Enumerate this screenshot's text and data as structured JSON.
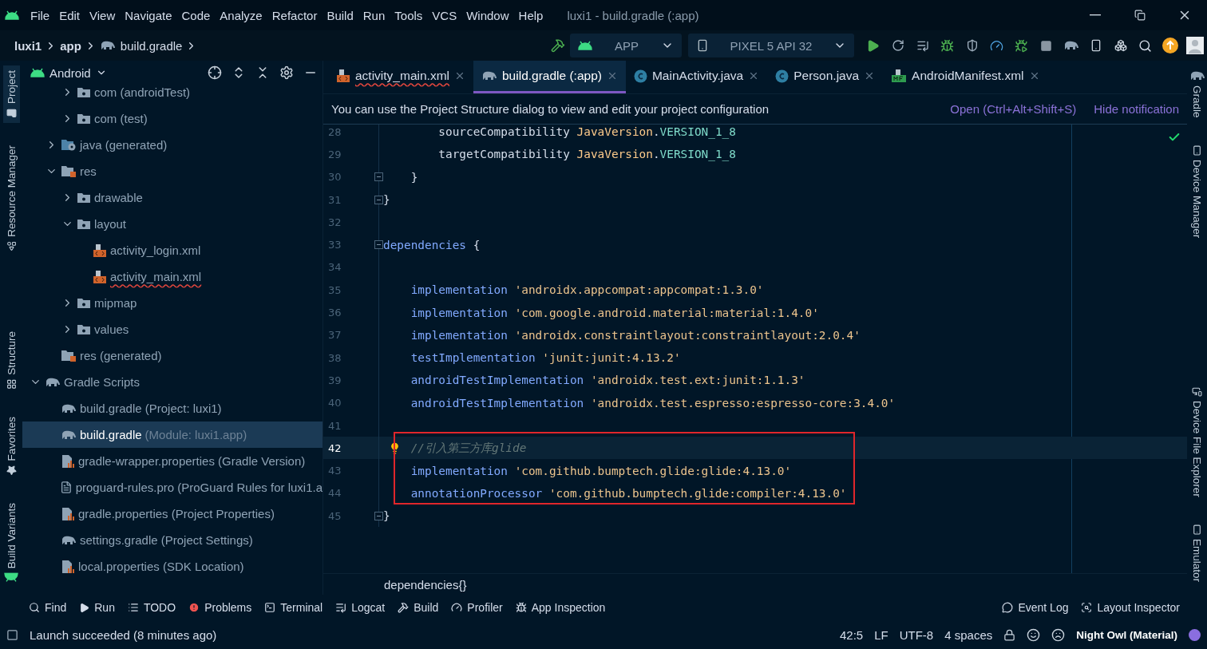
{
  "menu": [
    "File",
    "Edit",
    "View",
    "Navigate",
    "Code",
    "Analyze",
    "Refactor",
    "Build",
    "Run",
    "Tools",
    "VCS",
    "Window",
    "Help"
  ],
  "window_title": "luxi1 - build.gradle (:app)",
  "breadcrumbs": [
    {
      "label": "luxi1",
      "kind": "module"
    },
    {
      "label": "app",
      "kind": "module"
    },
    {
      "label": "build.gradle",
      "kind": "gradle"
    }
  ],
  "run_config": {
    "label": "APP"
  },
  "device": {
    "label": "PIXEL 5 API 32"
  },
  "left_strip": {
    "top": [
      {
        "label": "Project",
        "selected": true
      },
      {
        "label": "Resource Manager",
        "selected": false
      }
    ],
    "bottom": [
      {
        "label": "Structure",
        "selected": false
      },
      {
        "label": "Favorites",
        "selected": false
      },
      {
        "label": "Build Variants",
        "selected": false
      }
    ]
  },
  "project_panel": {
    "view": "Android",
    "tree": [
      {
        "children": [
          {
            "children": [
              {
                "label": "com (androidTest)",
                "kind": "package",
                "expanded": false,
                "selected": false
              },
              {
                "label": "com (test)",
                "kind": "package",
                "expanded": false,
                "selected": false
              }
            ]
          },
          {
            "label": "java (generated)",
            "kind": "java-gen",
            "expanded": false,
            "selected": false
          },
          {
            "label": "res",
            "kind": "res",
            "expanded": true,
            "selected": false,
            "children": [
              {
                "label": "drawable",
                "kind": "package",
                "expanded": false,
                "selected": false
              },
              {
                "label": "layout",
                "kind": "package",
                "expanded": true,
                "selected": false,
                "children": [
                  {
                    "label": "activity_login.xml",
                    "kind": "xml",
                    "error": false,
                    "selected": false
                  },
                  {
                    "label": "activity_main.xml",
                    "kind": "xml",
                    "error": true,
                    "selected": false
                  }
                ]
              },
              {
                "label": "mipmap",
                "kind": "package",
                "expanded": false,
                "selected": false
              },
              {
                "label": "values",
                "kind": "package",
                "expanded": false,
                "selected": false
              }
            ]
          },
          {
            "label": "res (generated)",
            "kind": "res",
            "selected": false
          }
        ]
      },
      {
        "label": "Gradle Scripts",
        "kind": "gradle",
        "expanded": true,
        "selected": false,
        "children": [
          {
            "label": "build.gradle (Project: luxi1)",
            "kind": "gradle",
            "selected": false
          },
          {
            "label": "build.gradle",
            "note": "(Module: luxi1.app)",
            "kind": "gradle",
            "selected": true
          },
          {
            "label": "gradle-wrapper.properties (Gradle Version)",
            "kind": "properties",
            "selected": false
          },
          {
            "label": "proguard-rules.pro (ProGuard Rules for luxi1.a",
            "kind": "file",
            "selected": false
          },
          {
            "label": "gradle.properties (Project Properties)",
            "kind": "properties",
            "selected": false
          },
          {
            "label": "settings.gradle (Project Settings)",
            "kind": "gradle",
            "selected": false
          },
          {
            "label": "local.properties (SDK Location)",
            "kind": "properties",
            "selected": false
          }
        ]
      }
    ]
  },
  "tabs": [
    {
      "label": "activity_main.xml",
      "kind": "xml",
      "error": true,
      "selected": false
    },
    {
      "label": "build.gradle (:app)",
      "kind": "gradle",
      "error": false,
      "selected": true
    },
    {
      "label": "MainActivity.java",
      "kind": "class",
      "error": false,
      "selected": false
    },
    {
      "label": "Person.java",
      "kind": "class",
      "error": false,
      "selected": false
    },
    {
      "label": "AndroidManifest.xml",
      "kind": "manifest",
      "error": false,
      "selected": false
    }
  ],
  "notification": {
    "message": "You can use the Project Structure dialog to view and edit your project configuration",
    "actions": [
      "Open (Ctrl+Alt+Shift+S)",
      "Hide notification"
    ]
  },
  "code_lines": [
    {
      "number": "28",
      "current": false,
      "fold": false,
      "boxed": false,
      "tokens": [
        {
          "text": "        sourceCompatibility ",
          "kind": "plain"
        },
        {
          "text": "JavaVersion",
          "kind": "type"
        },
        {
          "text": ".",
          "kind": "plain"
        },
        {
          "text": "VERSION_1_8",
          "kind": "const"
        }
      ]
    },
    {
      "number": "29",
      "current": false,
      "fold": false,
      "boxed": false,
      "tokens": [
        {
          "text": "        targetCompatibility ",
          "kind": "plain"
        },
        {
          "text": "JavaVersion",
          "kind": "type"
        },
        {
          "text": ".",
          "kind": "plain"
        },
        {
          "text": "VERSION_1_8",
          "kind": "const"
        }
      ]
    },
    {
      "number": "30",
      "current": false,
      "fold": true,
      "boxed": false,
      "tokens": [
        {
          "text": "    }",
          "kind": "plain"
        }
      ]
    },
    {
      "number": "31",
      "current": false,
      "fold": true,
      "boxed": false,
      "tokens": [
        {
          "text": "}",
          "kind": "plain"
        }
      ]
    },
    {
      "number": "32",
      "current": false,
      "fold": false,
      "boxed": false
    },
    {
      "number": "33",
      "current": false,
      "fold": true,
      "boxed": false,
      "tokens": [
        {
          "text": "dependencies",
          "kind": "fn"
        },
        {
          "text": " {",
          "kind": "plain"
        }
      ]
    },
    {
      "number": "34",
      "current": false,
      "fold": false,
      "boxed": false
    },
    {
      "number": "35",
      "current": false,
      "fold": false,
      "boxed": false,
      "tokens": [
        {
          "text": "    implementation ",
          "kind": "fn"
        },
        {
          "text": "'androidx.appcompat:appcompat:1.3.0'",
          "kind": "str"
        }
      ]
    },
    {
      "number": "36",
      "current": false,
      "fold": false,
      "boxed": false,
      "tokens": [
        {
          "text": "    implementation ",
          "kind": "fn"
        },
        {
          "text": "'com.google.android.material:material:1.4.0'",
          "kind": "str"
        }
      ]
    },
    {
      "number": "37",
      "current": false,
      "fold": false,
      "boxed": false,
      "tokens": [
        {
          "text": "    implementation ",
          "kind": "fn"
        },
        {
          "text": "'androidx.constraintlayout:constraintlayout:2.0.4'",
          "kind": "str"
        }
      ]
    },
    {
      "number": "38",
      "current": false,
      "fold": false,
      "boxed": false,
      "tokens": [
        {
          "text": "    testImplementation ",
          "kind": "fn"
        },
        {
          "text": "'junit:junit:4.13.2'",
          "kind": "str"
        }
      ]
    },
    {
      "number": "39",
      "current": false,
      "fold": false,
      "boxed": false,
      "tokens": [
        {
          "text": "    androidTestImplementation ",
          "kind": "fn"
        },
        {
          "text": "'androidx.test.ext:junit:1.1.3'",
          "kind": "str"
        }
      ]
    },
    {
      "number": "40",
      "current": false,
      "fold": false,
      "boxed": false,
      "tokens": [
        {
          "text": "    androidTestImplementation ",
          "kind": "fn"
        },
        {
          "text": "'androidx.test.espresso:espresso-core:3.4.0'",
          "kind": "str"
        }
      ]
    },
    {
      "number": "41",
      "current": false,
      "fold": false,
      "boxed": false
    },
    {
      "number": "42",
      "current": true,
      "fold": false,
      "boxed": true,
      "tokens": [
        {
          "text": "    //引入第三方库glide",
          "kind": "comment"
        }
      ]
    },
    {
      "number": "43",
      "current": false,
      "fold": false,
      "boxed": true,
      "tokens": [
        {
          "text": "    implementation ",
          "kind": "fn"
        },
        {
          "text": "'com.github.bumptech.glide:glide:4.13.0'",
          "kind": "str"
        }
      ]
    },
    {
      "number": "44",
      "current": false,
      "fold": false,
      "boxed": true,
      "tokens": [
        {
          "text": "    annotationProcessor ",
          "kind": "fn"
        },
        {
          "text": "'com.github.bumptech.glide:compiler:4.13.0'",
          "kind": "str"
        }
      ]
    },
    {
      "number": "45",
      "current": false,
      "fold": true,
      "boxed": false,
      "tokens": [
        {
          "text": "}",
          "kind": "plain"
        }
      ]
    }
  ],
  "editor_breadcrumb": "dependencies{}",
  "right_strip": {
    "top": [
      {
        "label": "Gradle",
        "selected": false
      },
      {
        "label": "Device Manager",
        "selected": false
      }
    ],
    "bottom": [
      {
        "label": "Device File Explorer",
        "selected": false
      },
      {
        "label": "Emulator",
        "selected": false
      }
    ]
  },
  "tool_windows": {
    "left": [
      "Find",
      "Run",
      "TODO",
      "Problems",
      "Terminal",
      "Logcat",
      "Build",
      "Profiler",
      "App Inspection"
    ],
    "right": [
      "Event Log",
      "Layout Inspector"
    ]
  },
  "status_bar": {
    "message": "Launch succeeded (8 minutes ago)",
    "position": "42:5",
    "line_separator": "LF",
    "encoding": "UTF-8",
    "indent": "4 spaces",
    "theme": "Night Owl (Material)"
  }
}
